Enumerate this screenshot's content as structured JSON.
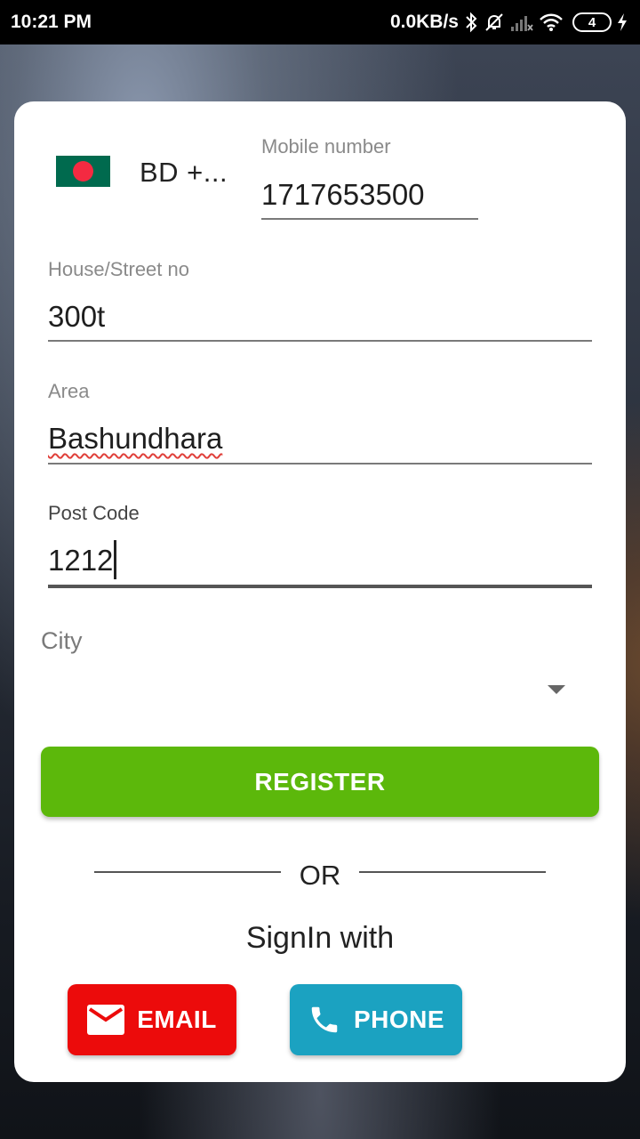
{
  "status_bar": {
    "time": "10:21 PM",
    "network_speed": "0.0KB/s",
    "battery_level": "4",
    "icons": [
      "bluetooth-icon",
      "bell-muted-icon",
      "signal-icon",
      "wifi-icon",
      "battery-icon",
      "charging-icon"
    ]
  },
  "form": {
    "country": {
      "flag": "bangladesh-flag",
      "code_text": "BD  +..."
    },
    "mobile": {
      "label": "Mobile number",
      "value": "1717653500"
    },
    "house": {
      "label": "House/Street no",
      "value": "300t"
    },
    "area": {
      "label": "Area",
      "value": "Bashundhara"
    },
    "post_code": {
      "label": "Post Code",
      "value": "1212"
    },
    "city": {
      "label": "City",
      "selected": ""
    },
    "register_label": "REGISTER"
  },
  "divider": {
    "or_text": "OR"
  },
  "signin": {
    "title": "SignIn with",
    "email_label": "EMAIL",
    "phone_label": "PHONE"
  },
  "colors": {
    "register": "#5cb80b",
    "email": "#ec0b0b",
    "phone": "#1ba2c1"
  }
}
